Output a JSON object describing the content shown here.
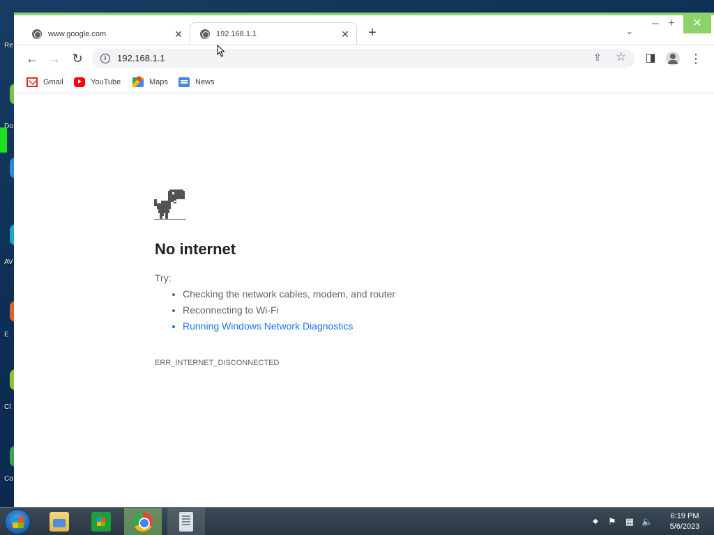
{
  "tabs": [
    {
      "title": "www.google.com"
    },
    {
      "title": "192.168.1.1"
    }
  ],
  "window": {
    "minimize": "–",
    "maximize": "+",
    "close": "✕"
  },
  "toolbar": {
    "url": "192.168.1.1"
  },
  "bookmarks": [
    {
      "label": "Gmail"
    },
    {
      "label": "YouTube"
    },
    {
      "label": "Maps"
    },
    {
      "label": "News"
    }
  ],
  "page": {
    "heading": "No internet",
    "try_label": "Try:",
    "suggestions": [
      "Checking the network cables, modem, and router",
      "Reconnecting to Wi-Fi",
      "Running Windows Network Diagnostics"
    ],
    "error_code": "ERR_INTERNET_DISCONNECTED"
  },
  "desktop_labels": [
    "Re",
    "Do",
    "AV",
    "E",
    "Cl",
    "Co"
  ],
  "taskbar": {
    "time": "6:19 PM",
    "date": "5/6/2023"
  },
  "colors": {
    "link": "#1a73e8",
    "text": "#202124",
    "secondary": "#5f6368",
    "window_accent": "#8ed36a"
  }
}
